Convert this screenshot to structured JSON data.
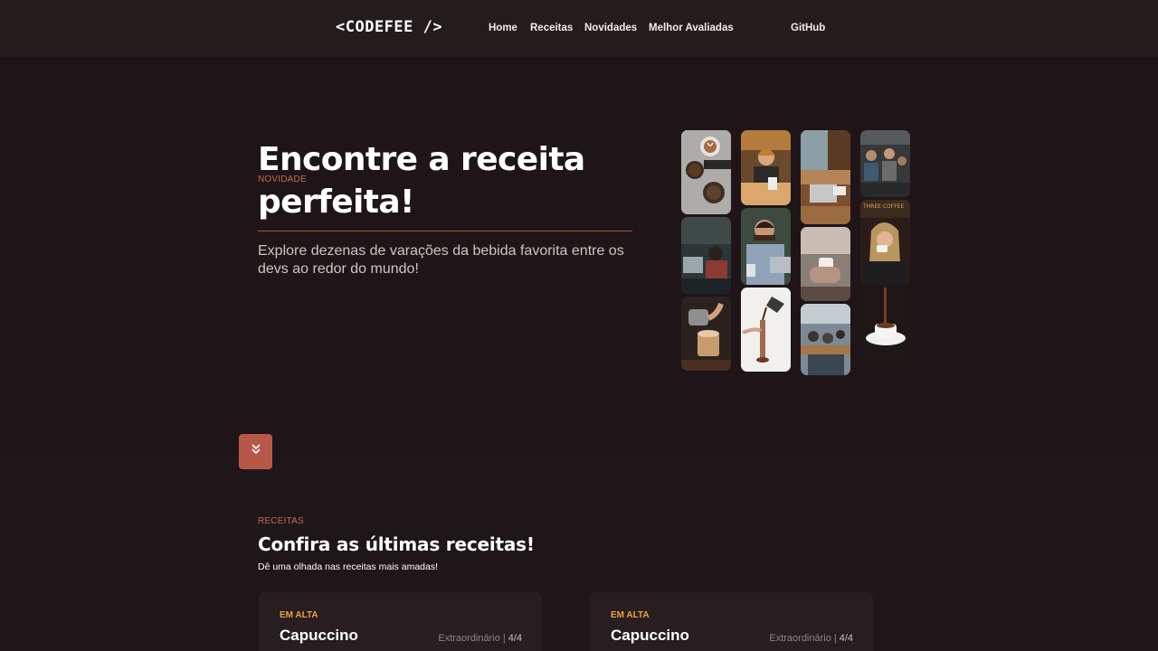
{
  "brand": {
    "logo": "<CODEFEE />"
  },
  "nav": {
    "home": "Home",
    "recipes": "Receitas",
    "news": "Novidades",
    "top_rated": "Melhor Avaliadas",
    "github": "GitHub"
  },
  "hero": {
    "eyebrow": "NOVIDADE",
    "title": "Encontre a receita perfeita!",
    "subtitle": "Explore dezenas de varações da bebida favorita entre os devs ao redor do mundo!"
  },
  "gallery": {
    "photos": [
      "latte-art-and-beans",
      "barista-woman",
      "cafe-window-laptop",
      "coffee-shop-crowd",
      "people-at-laptops",
      "man-with-coffee",
      "cup-in-hands",
      "woman-drinking-coffee",
      "barista-pouring-milk",
      "coffee-pour-over",
      "office-meeting",
      "cup-being-poured"
    ]
  },
  "icons": {
    "scroll_down": "chevrons-down-icon"
  },
  "recipes": {
    "eyebrow": "RECEITAS",
    "title": "Confira as últimas receitas!",
    "subtitle": "Dê uma olhada nas receitas mais amadas!",
    "cards": [
      {
        "badge": "EM ALTA",
        "name": "Capuccino",
        "rating_label": "Extraordinário",
        "separator": "|",
        "score": "4/4"
      },
      {
        "badge": "EM ALTA",
        "name": "Capuccino",
        "rating_label": "Extraordinário",
        "separator": "|",
        "score": "4/4"
      }
    ]
  },
  "colors": {
    "background": "#1f1519",
    "navbar": "#231b1c",
    "accent": "#b5584a",
    "eyebrow": "#c26a52",
    "badge": "#e9a23b"
  }
}
